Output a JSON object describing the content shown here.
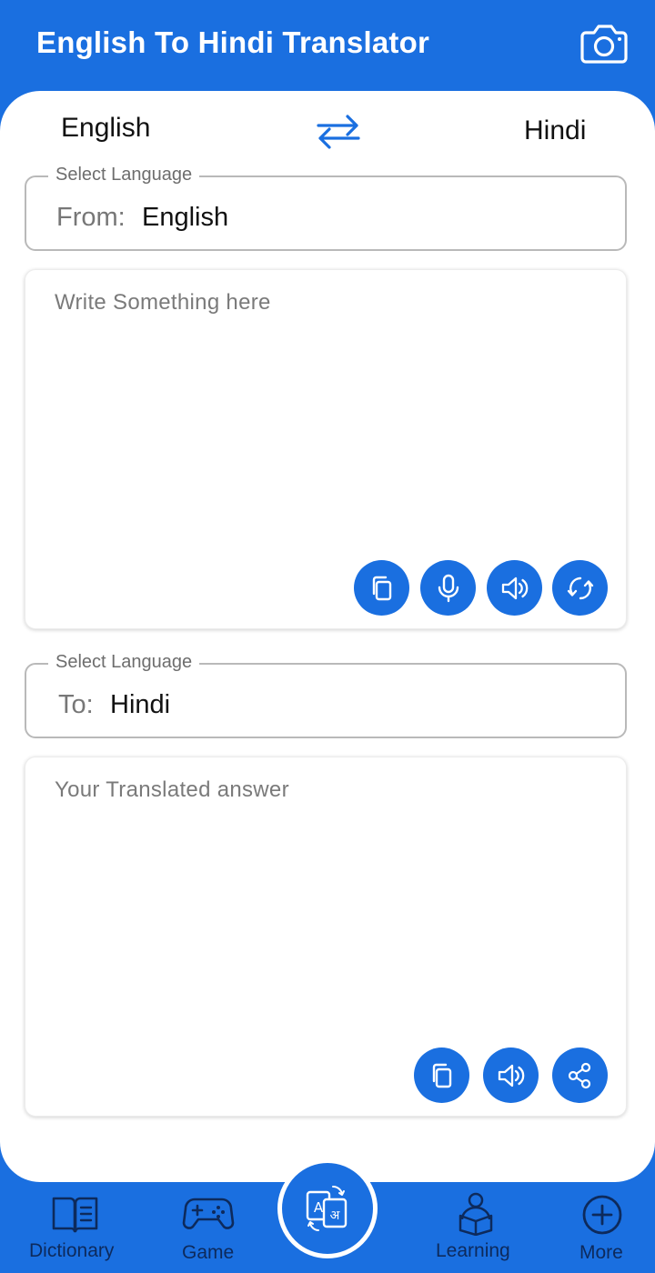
{
  "header": {
    "title": "English To Hindi Translator",
    "camera_icon": "camera-icon"
  },
  "language_switch": {
    "left": "English",
    "right": "Hindi",
    "swap_icon": "swap-arrows-icon"
  },
  "source": {
    "legend": "Select Language",
    "prefix": "From:",
    "value": "English",
    "placeholder": "Write Something here",
    "actions": [
      "copy-icon",
      "microphone-icon",
      "speaker-icon",
      "refresh-icon"
    ]
  },
  "target": {
    "legend": "Select Language",
    "prefix": "To:",
    "value": "Hindi",
    "placeholder": "Your Translated answer",
    "actions": [
      "copy-icon",
      "speaker-icon",
      "share-icon"
    ]
  },
  "nav": {
    "dictionary": "Dictionary",
    "game": "Game",
    "learning": "Learning",
    "more": "More",
    "center_icon": "translate-icon"
  },
  "colors": {
    "primary": "#1a6fe0",
    "nav_text": "#0d2a5c",
    "background": "#ffffff"
  }
}
